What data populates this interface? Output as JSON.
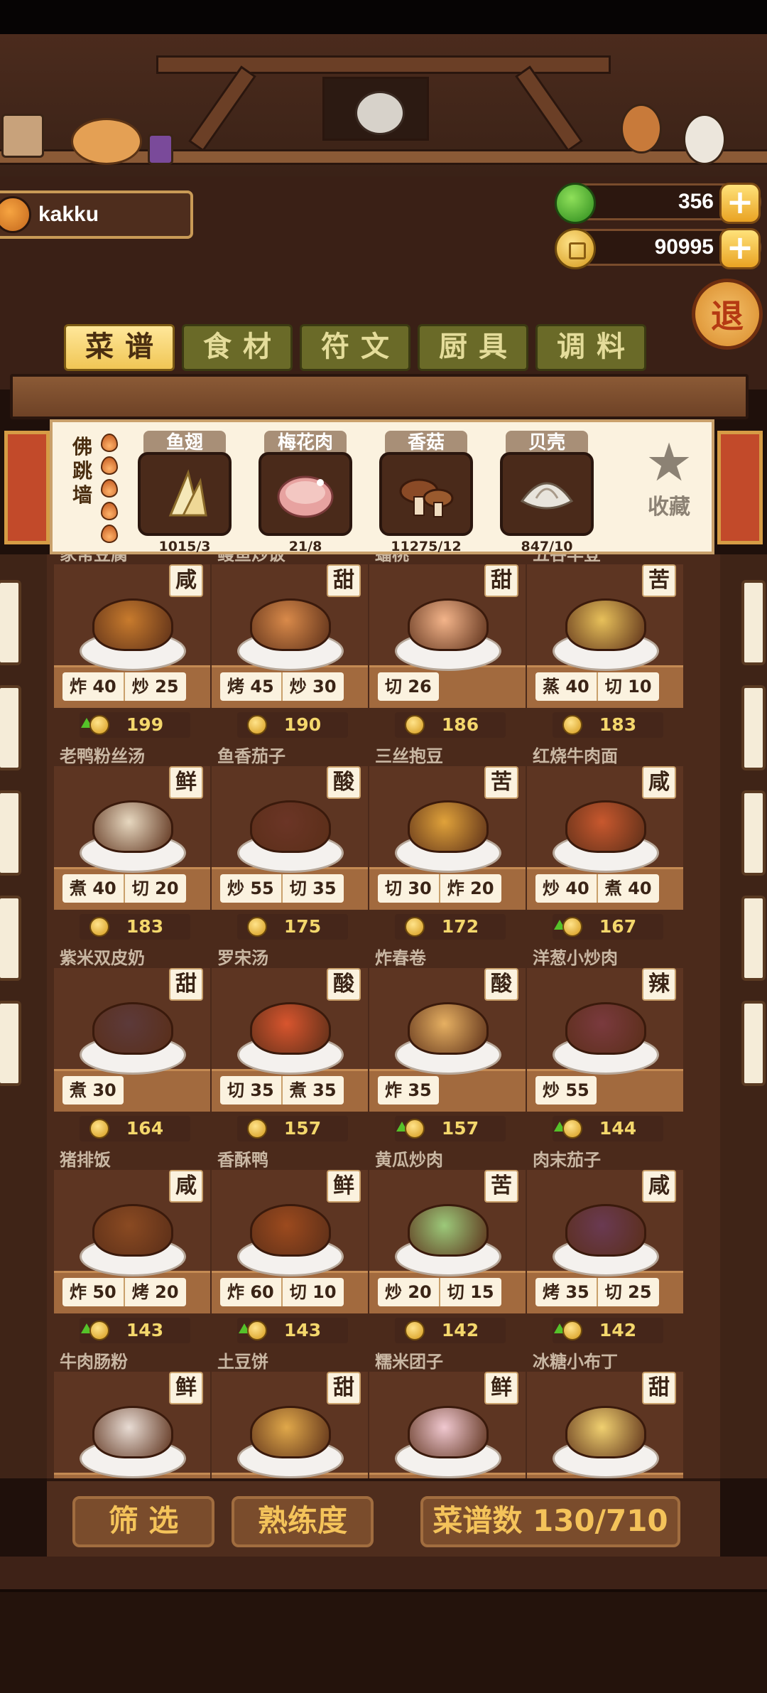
{
  "player": {
    "name": "kakku"
  },
  "currency": {
    "gems": "356",
    "coins": "90995",
    "plus_label": "+"
  },
  "exit_label": "退",
  "tabs": [
    {
      "label": "菜谱",
      "active": true
    },
    {
      "label": "食材",
      "active": false
    },
    {
      "label": "符文",
      "active": false
    },
    {
      "label": "厨具",
      "active": false
    },
    {
      "label": "调料",
      "active": false
    }
  ],
  "selected_dish": {
    "name": "佛跳墙",
    "flames": 5,
    "ingredients": [
      {
        "name": "鱼翅",
        "count": "1015/3",
        "icon": "shark-fin-icon"
      },
      {
        "name": "梅花肉",
        "count": "21/8",
        "icon": "pork-icon"
      },
      {
        "name": "香菇",
        "count": "11275/12",
        "icon": "mushroom-icon"
      },
      {
        "name": "贝壳",
        "count": "847/10",
        "icon": "shell-icon"
      }
    ],
    "favorite_label": "收藏"
  },
  "recipes": [
    {
      "name": "家常豆腐",
      "taste": "咸",
      "skills": [
        "炸 40",
        "炒 25"
      ],
      "price": "199",
      "up": true,
      "color": "#c87b2d"
    },
    {
      "name": "鳗鱼炒饭",
      "taste": "甜",
      "skills": [
        "烤 45",
        "炒 30"
      ],
      "price": "190",
      "up": false,
      "color": "#d98a4a"
    },
    {
      "name": "蟠桃",
      "taste": "甜",
      "skills": [
        "切 26"
      ],
      "price": "186",
      "up": false,
      "color": "#f3b48a"
    },
    {
      "name": "五谷丰登",
      "taste": "苦",
      "skills": [
        "蒸 40",
        "切 10"
      ],
      "price": "183",
      "up": false,
      "color": "#e7c05a"
    },
    {
      "name": "老鸭粉丝汤",
      "taste": "鲜",
      "skills": [
        "煮 40",
        "切 20"
      ],
      "price": "183",
      "up": false,
      "color": "#e7d8c0"
    },
    {
      "name": "鱼香茄子",
      "taste": "酸",
      "skills": [
        "炒 55",
        "切 35"
      ],
      "price": "175",
      "up": false,
      "color": "#6b3526"
    },
    {
      "name": "三丝抱豆",
      "taste": "苦",
      "skills": [
        "切 30",
        "炸 20"
      ],
      "price": "172",
      "up": false,
      "color": "#e0a23a"
    },
    {
      "name": "红烧牛肉面",
      "taste": "咸",
      "skills": [
        "炒 40",
        "煮 40"
      ],
      "price": "167",
      "up": true,
      "color": "#c8582e"
    },
    {
      "name": "紫米双皮奶",
      "taste": "甜",
      "skills": [
        "煮 30"
      ],
      "price": "164",
      "up": false,
      "color": "#5c3a3a"
    },
    {
      "name": "罗宋汤",
      "taste": "酸",
      "skills": [
        "切 35",
        "煮 35"
      ],
      "price": "157",
      "up": false,
      "color": "#d8552e"
    },
    {
      "name": "炸春卷",
      "taste": "酸",
      "skills": [
        "炸 35"
      ],
      "price": "157",
      "up": true,
      "color": "#e6b062"
    },
    {
      "name": "洋葱小炒肉",
      "taste": "辣",
      "skills": [
        "炒 55"
      ],
      "price": "144",
      "up": true,
      "color": "#7a3a3e"
    },
    {
      "name": "猪排饭",
      "taste": "咸",
      "skills": [
        "炸 50",
        "烤 20"
      ],
      "price": "143",
      "up": true,
      "color": "#8a4a22"
    },
    {
      "name": "香酥鸭",
      "taste": "鲜",
      "skills": [
        "炸 60",
        "切 10"
      ],
      "price": "143",
      "up": true,
      "color": "#9c4a1e"
    },
    {
      "name": "黄瓜炒肉",
      "taste": "苦",
      "skills": [
        "炒 20",
        "切 15"
      ],
      "price": "142",
      "up": false,
      "color": "#9cc97a"
    },
    {
      "name": "肉末茄子",
      "taste": "咸",
      "skills": [
        "烤 35",
        "切 25"
      ],
      "price": "142",
      "up": true,
      "color": "#6a3a52"
    },
    {
      "name": "牛肉肠粉",
      "taste": "鲜",
      "skills": [],
      "price": "",
      "up": false,
      "color": "#e8dcd4"
    },
    {
      "name": "土豆饼",
      "taste": "甜",
      "skills": [],
      "price": "",
      "up": false,
      "color": "#e0a84a"
    },
    {
      "name": "糯米团子",
      "taste": "鲜",
      "skills": [],
      "price": "",
      "up": false,
      "color": "#f0c8d0"
    },
    {
      "name": "冰糖小布丁",
      "taste": "甜",
      "skills": [],
      "price": "",
      "up": false,
      "color": "#f0d070"
    }
  ],
  "bottom": {
    "filter_label": "筛 选",
    "mastery_label": "熟练度",
    "recipe_count_label": "菜谱数 130/710"
  }
}
